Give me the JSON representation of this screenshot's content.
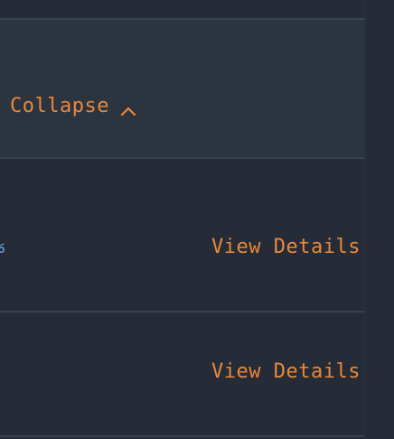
{
  "colors": {
    "background": "#252b37",
    "header_background": "#2c3440",
    "accent": "#e8893a",
    "secondary_accent": "#6ea0e6",
    "divider": "#3a4250"
  },
  "header": {
    "collapse_label": "Collapse",
    "collapse_icon": "chevron-up-icon"
  },
  "rows": [
    {
      "partial_value": "%",
      "action_label": "View Details"
    },
    {
      "action_label": "View Details"
    }
  ]
}
